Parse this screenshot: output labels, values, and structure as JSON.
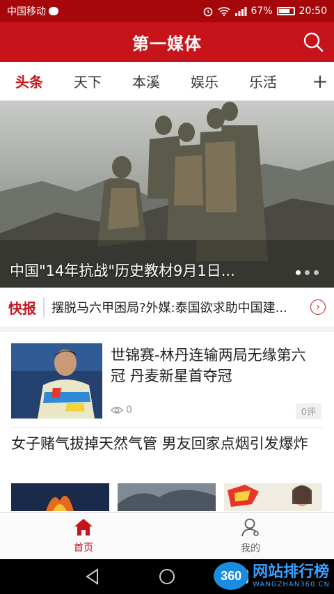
{
  "status_bar": {
    "carrier": "中国移动",
    "battery": "67%",
    "battery_level": 0.67,
    "time": "20:50"
  },
  "app_bar": {
    "title": "第一媒体",
    "search_icon": "search-icon"
  },
  "tabs": [
    {
      "label": "头条",
      "active": true
    },
    {
      "label": "天下",
      "active": false
    },
    {
      "label": "本溪",
      "active": false
    },
    {
      "label": "娱乐",
      "active": false
    },
    {
      "label": "乐活",
      "active": false
    }
  ],
  "tab_add": "+",
  "hero": {
    "caption": "中国\"14年抗战\"历史教材9月1日...",
    "slide_count": 3,
    "current_slide": 1
  },
  "flash": {
    "label": "快报",
    "text": "摆脱马六甲困局?外媒:泰国欲求助中国建...",
    "more_icon": "chevron-right-icon"
  },
  "news": [
    {
      "headline": "世锦赛-林丹连输两局无缘第六冠 丹麦新星首夺冠",
      "views": "0",
      "comments": "0评"
    },
    {
      "headline": "女子赌气拔掉天然气管 男友回家点烟引发爆炸"
    }
  ],
  "bottom_nav": [
    {
      "label": "首页",
      "icon": "home-icon",
      "active": true
    },
    {
      "label": "我的",
      "icon": "user-icon",
      "active": false
    }
  ],
  "watermark": {
    "badge": "360",
    "main": "网站排行榜",
    "sub": "WANGZHAN360.CN"
  },
  "colors": {
    "brand_red": "#c7141a",
    "status_bar": "#a5070a"
  }
}
